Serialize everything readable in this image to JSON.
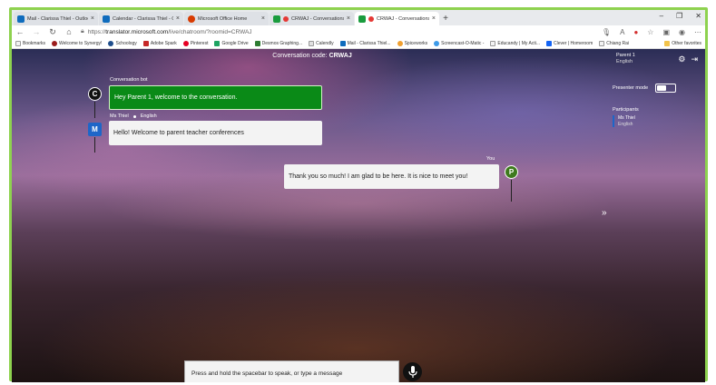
{
  "browser": {
    "tabs": [
      {
        "label": "Mail - Clarissa Thiel - Outlook",
        "color": "#0f6cbd",
        "active": false
      },
      {
        "label": "Calendar - Clarissa Thiel - Outlo",
        "color": "#0f6cbd",
        "active": false
      },
      {
        "label": "Microsoft Office Home",
        "color": "#d83b01",
        "active": false
      },
      {
        "label": "CRWAJ - Conversations - Mi",
        "color": "#1a9c3e",
        "active": false
      },
      {
        "label": "CRWAJ - Conversations - Mi",
        "color": "#1a9c3e",
        "active": true
      }
    ],
    "new_tab": "+",
    "window_controls": [
      "–",
      "❐",
      "✕"
    ],
    "url_prefix": "https://",
    "url_domain": "translator.microsoft.com",
    "url_path": "/live/chatroom/?roomid=CRWAJ",
    "bookmarks": [
      {
        "label": "Bookmarks",
        "color": "#f2f2f2"
      },
      {
        "label": "Welcome to Synergy!",
        "color": "#9b1c1c"
      },
      {
        "label": "Schoology",
        "color": "#1f4e8c"
      },
      {
        "label": "Adobe Spark",
        "color": "#c62828"
      },
      {
        "label": "Pinterest",
        "color": "#e60023"
      },
      {
        "label": "Google Drive",
        "color": "#1fa463"
      },
      {
        "label": "Desmos Graphing...",
        "color": "#2e7d32"
      },
      {
        "label": "Calendly",
        "color": "#e0e0e0"
      },
      {
        "label": "Mail - Clarissa Thiel...",
        "color": "#0f6cbd"
      },
      {
        "label": "Spiceworks",
        "color": "#f0a030"
      },
      {
        "label": "Screencast-O-Matic -",
        "color": "#3d9be9"
      },
      {
        "label": "Educandy | My Acti...",
        "color": "#f2f2f2"
      },
      {
        "label": "Clever | Homeroom",
        "color": "#1464f4"
      },
      {
        "label": "Chiang Rai",
        "color": "#f2f2f2"
      }
    ],
    "other_favorites": "Other favorites"
  },
  "chat": {
    "code_label": "Conversation code:",
    "code": "CRWAJ",
    "messages": [
      {
        "sender": "Conversation bot",
        "avatar": "C",
        "text": "Hey Parent 1, welcome to the conversation."
      },
      {
        "sender": "Ms Thiel",
        "language": "English",
        "avatar": "M",
        "text": "Hello! Welcome to parent teacher conferences"
      },
      {
        "sender": "You",
        "avatar": "P",
        "text": "Thank you so much! I am glad to be here. It is nice to meet you!"
      }
    ],
    "input_placeholder": "Press and hold the spacebar to speak, or type a message"
  },
  "sidebar": {
    "user_name": "Parent 1",
    "user_language": "English",
    "presenter_mode_label": "Presenter mode",
    "presenter_mode_on": false,
    "participants_title": "Participants",
    "participants": [
      {
        "name": "Ms Thiel",
        "language": "English"
      }
    ],
    "expand_glyph": "»"
  },
  "colors": {
    "bot_bubble": "#0a8a17",
    "avatar_bot": "#111111",
    "avatar_teacher": "#1e66c8",
    "avatar_you": "#3e7a1e",
    "frame_border": "#8ed24f"
  }
}
